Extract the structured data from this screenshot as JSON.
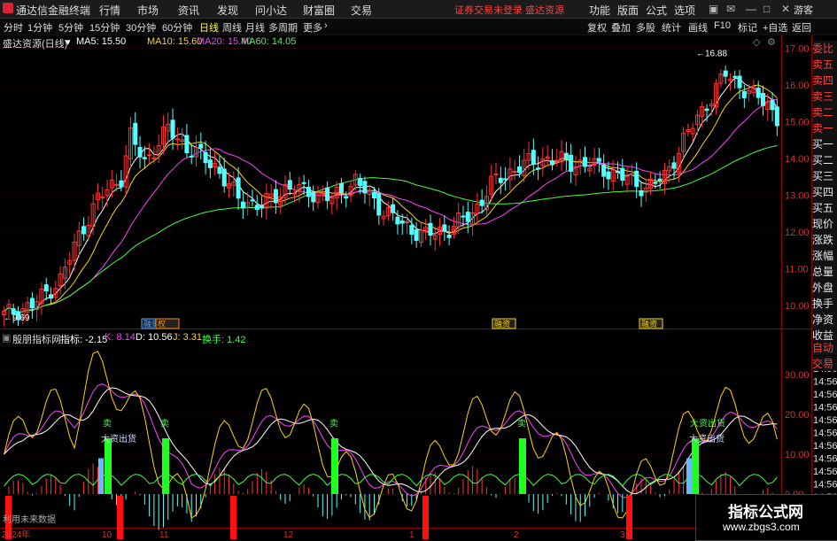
{
  "titlebar": {
    "app_name": "通达信金融终端",
    "menus": [
      "行情",
      "市场",
      "资讯",
      "发现",
      "问小达",
      "财富圈",
      "交易"
    ],
    "warning": "证券交易未登录  盛达资源",
    "right_menus": [
      "功能",
      "版面",
      "公式",
      "选项"
    ],
    "guest": "游客"
  },
  "toolbar": {
    "periods": [
      "分时",
      "1分钟",
      "5分钟",
      "15分钟",
      "30分钟",
      "60分钟",
      "日线",
      "周线",
      "月线",
      "多周期",
      "更多"
    ],
    "active_period": "日线",
    "right": [
      "复权",
      "叠加",
      "多股",
      "统计",
      "画线",
      "F10",
      "标记",
      "+自选",
      "返回"
    ]
  },
  "main_legend": {
    "stock": "盛达资源(日线)",
    "ma": [
      {
        "label": "MA5: 15.50",
        "color": "#ffffff"
      },
      {
        "label": "MA10: 15.60",
        "color": "#ffd700"
      },
      {
        "label": "MA20: 15.40",
        "color": "#ff40ff"
      },
      {
        "label": "MA60: 14.05",
        "color": "#40ff40"
      }
    ]
  },
  "indicator_legend": {
    "name": "殷朋指标网",
    "items": [
      {
        "label": "指标: -2.15",
        "color": "#ffffff"
      },
      {
        "label": "K: 8.14",
        "color": "#ff40ff"
      },
      {
        "label": "D: 10.56",
        "color": "#ffffff"
      },
      {
        "label": "J: 3.31",
        "color": "#ffd700"
      },
      {
        "label": "换手: 1.42",
        "color": "#40ff40"
      }
    ]
  },
  "side_panel": {
    "top": [
      "委比",
      "卖五",
      "卖四",
      "卖三",
      "卖二",
      "卖一",
      "买一",
      "买二",
      "买三",
      "买四",
      "买五",
      "现价",
      "涨跌",
      "涨幅",
      "总量",
      "外盘",
      "换手",
      "净资",
      "收益"
    ],
    "bottom": [
      "自动",
      "交易"
    ]
  },
  "chart_data": [
    {
      "type": "candlestick",
      "title": "盛达资源(日线)",
      "ylim": [
        9.4,
        17.3
      ],
      "y_ticks": [
        10.0,
        11.0,
        12.0,
        13.0,
        14.0,
        15.0,
        16.0,
        17.0
      ],
      "x_labels": [
        "2024年",
        "10",
        "11",
        "12",
        "1",
        "2",
        "3"
      ],
      "annotations": [
        {
          "text": "16.88",
          "type": "high"
        },
        {
          "text": "9.69",
          "type": "low"
        }
      ],
      "event_tags": [
        "融资",
        "权",
        "融资",
        "融资"
      ],
      "note": "approx. 145 daily candles from ~9.7 rising to peak 16.88"
    },
    {
      "type": "line",
      "title": "殷朋指标网",
      "ylim": [
        -8,
        38
      ],
      "y_ticks": [
        0.0,
        10.0,
        20.0,
        30.0
      ],
      "signals": [
        {
          "text": "大资出货"
        },
        {
          "text": "卖"
        },
        {
          "text": "卖"
        },
        {
          "text": "卖"
        },
        {
          "text": "卖"
        },
        {
          "text": "大资出货"
        }
      ],
      "note": "利用未来数据",
      "time_labels": [
        "14:56",
        "14:56",
        "14:56",
        "14:56",
        "14:56",
        "14:56",
        "14:56",
        "14:56",
        "14:56",
        "14:56",
        "14:56",
        "14:56"
      ]
    }
  ],
  "watermark": {
    "line1": "指标公式网",
    "line2": "www.zbgs3.com"
  }
}
